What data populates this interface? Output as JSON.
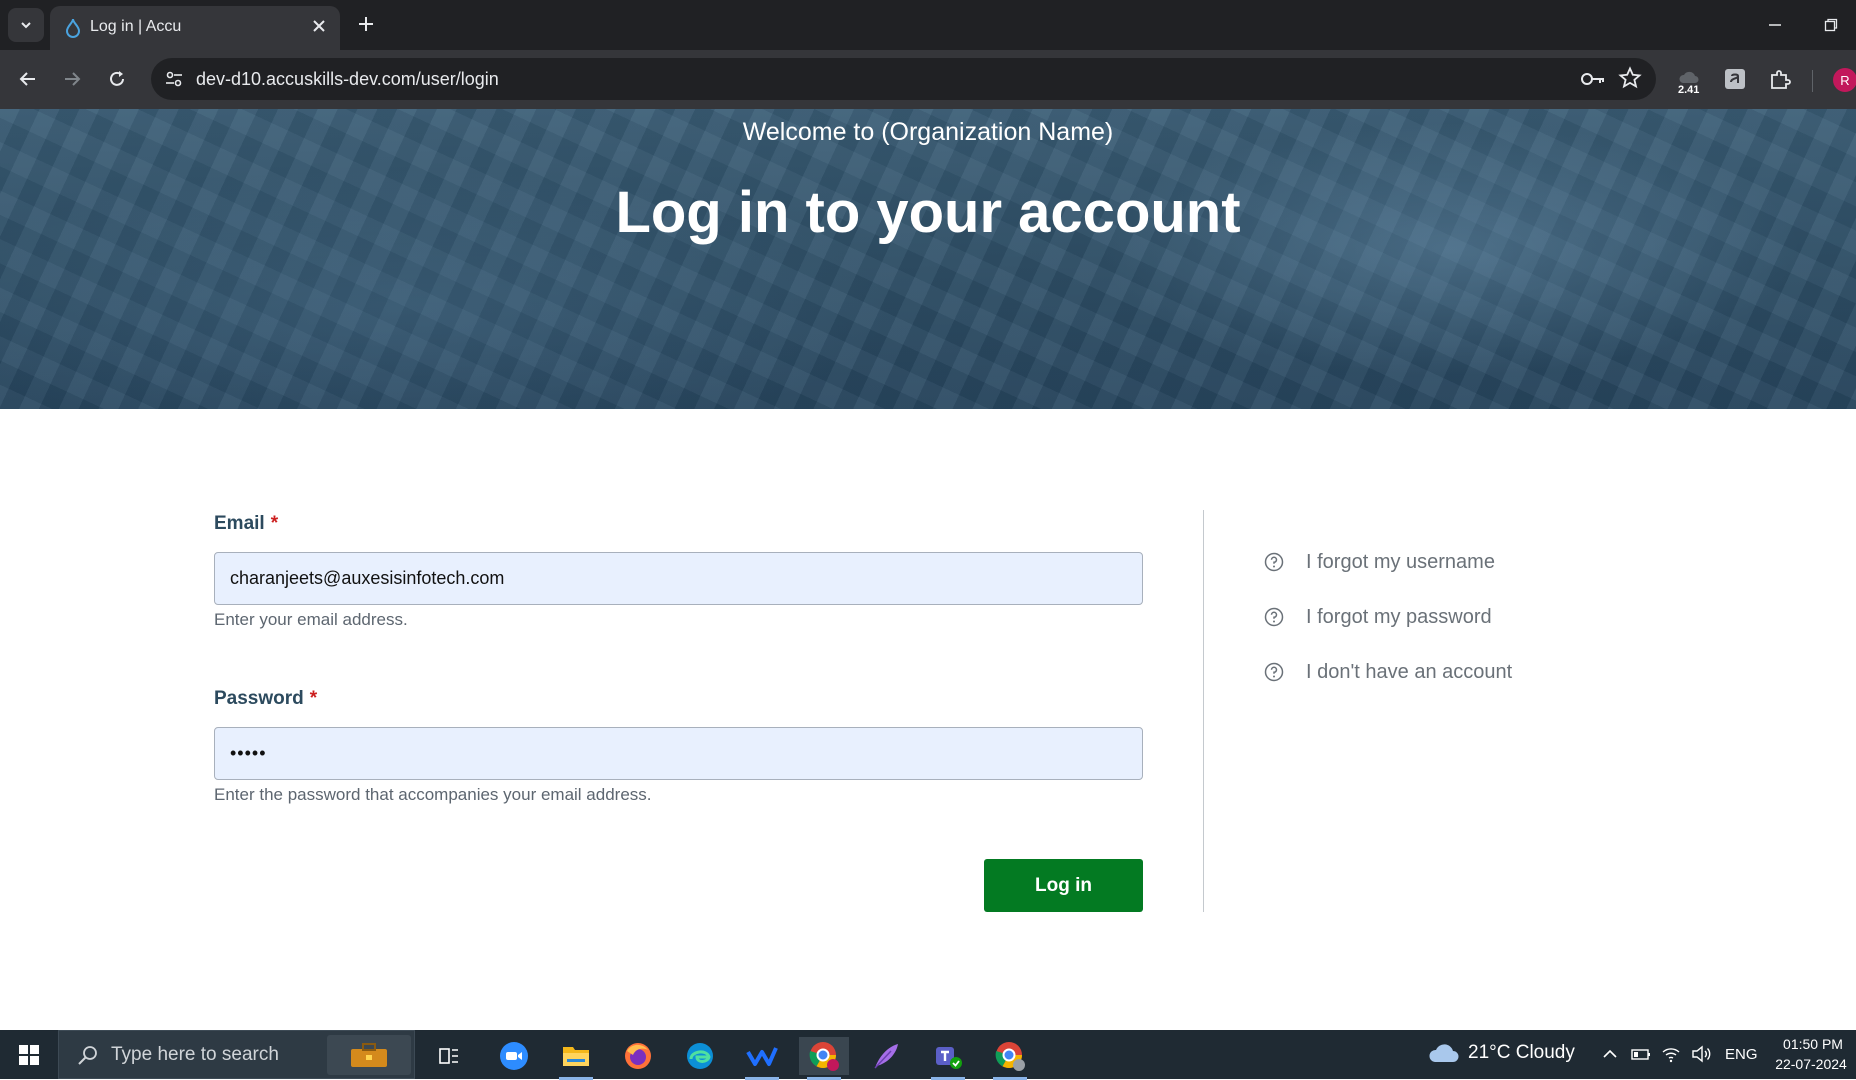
{
  "browser": {
    "tab_title": "Log in | Accu",
    "url": "dev-d10.accuskills-dev.com/user/login",
    "extension_badge": "2.41",
    "profile_initial": "R"
  },
  "hero": {
    "subtitle": "Welcome to (Organization Name)",
    "title": "Log in to your account"
  },
  "form": {
    "email_label": "Email",
    "email_required": "*",
    "email_value": "charanjeets@auxesisinfotech.com",
    "email_help": "Enter your email address.",
    "password_label": "Password",
    "password_required": "*",
    "password_value": "•••••",
    "password_help": "Enter the password that accompanies your email address.",
    "submit_label": "Log in"
  },
  "side_links": [
    {
      "label": "I forgot my username"
    },
    {
      "label": "I forgot my password"
    },
    {
      "label": "I don't have an account"
    }
  ],
  "taskbar": {
    "search_placeholder": "Type here to search",
    "weather": "21°C  Cloudy",
    "language": "ENG",
    "time": "01:50 PM",
    "date": "22-07-2024"
  },
  "colors": {
    "primary_button": "#037a22",
    "label_text": "#2c4a5e",
    "required_marker": "#cc1f1f",
    "hero_background": "#2f5068"
  }
}
